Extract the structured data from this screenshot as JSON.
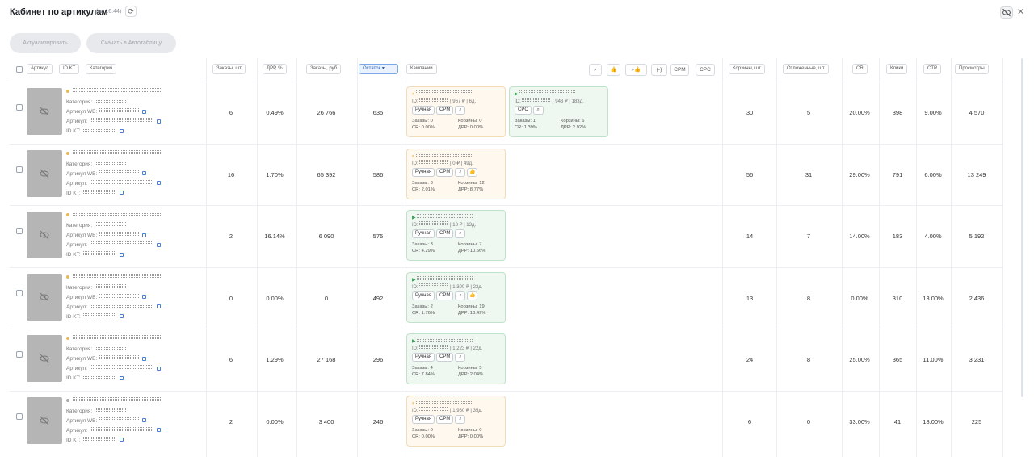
{
  "header": {
    "title": "Кабинет по артикулам",
    "subtitle": "(за 16:44)"
  },
  "actions": {
    "update": "Актуализировать",
    "download": "Скачать в Автотаблицу"
  },
  "columns": {
    "article": "Артикул",
    "idkt": "ID KT",
    "category": "Категория",
    "orders": "Заказы, шт",
    "drr": "ДРР, %",
    "orders_rub": "Заказы, руб",
    "stock": "Остаток",
    "campaigns": "Кампании",
    "carts": "Корзины, шт",
    "deferred": "Отложенные, шт",
    "cr": "CR",
    "clicks": "Клики",
    "ctr": "CTR",
    "views": "Просмотры"
  },
  "filters": {
    "cpm": "CPM",
    "cpc": "CPC",
    "braces": "{-}"
  },
  "labels": {
    "category": "Категория:",
    "art_wb": "Артикул WB:",
    "art": "Артикул:",
    "id_kt": "ID KT:",
    "id": "ID:",
    "manual": "Ручная",
    "cpm": "CPM",
    "cpc": "CPC",
    "orders": "Заказы:",
    "carts": "Корзины:",
    "cr": "CR:",
    "drr": "ДРР:"
  },
  "colors": {
    "accent": "#2a63b4",
    "warm": "#e6b85c",
    "green": "#3fa35b"
  },
  "rows": [
    {
      "orders": "6",
      "drr": "0.49%",
      "orders_rub": "26 766",
      "stock": "635",
      "carts": "30",
      "deferred": "5",
      "cr": "20.00%",
      "clicks": "398",
      "ctr": "9.00%",
      "views": "4 570",
      "status": "warm",
      "campaigns": [
        {
          "state": "paused",
          "meta": "| 967 ₽ | 6д.",
          "tags": [
            "manual",
            "cpm",
            "search"
          ],
          "orders": "0",
          "carts": "0",
          "cr": "0.00%",
          "drr": "0.00%"
        },
        {
          "state": "active",
          "meta": "| 943 ₽ | 183д.",
          "tags": [
            "cpc",
            "search"
          ],
          "orders": "1",
          "carts": "6",
          "cr": "1.39%",
          "drr": "2.92%"
        }
      ]
    },
    {
      "orders": "16",
      "drr": "1.70%",
      "orders_rub": "65 392",
      "stock": "586",
      "carts": "56",
      "deferred": "31",
      "cr": "29.00%",
      "clicks": "791",
      "ctr": "6.00%",
      "views": "13 249",
      "status": "warm",
      "campaigns": [
        {
          "state": "paused",
          "meta": "| 0 ₽ | 49д.",
          "tags": [
            "manual",
            "cpm",
            "search",
            "like"
          ],
          "orders": "3",
          "carts": "12",
          "cr": "2.01%",
          "drr": "8.77%"
        }
      ]
    },
    {
      "orders": "2",
      "drr": "16.14%",
      "orders_rub": "6 090",
      "stock": "575",
      "carts": "14",
      "deferred": "7",
      "cr": "14.00%",
      "clicks": "183",
      "ctr": "4.00%",
      "views": "5 192",
      "status": "warm",
      "campaigns": [
        {
          "state": "active",
          "meta": "| 18 ₽ | 13д.",
          "tags": [
            "manual",
            "cpm",
            "search"
          ],
          "orders": "3",
          "carts": "7",
          "cr": "4.29%",
          "drr": "10.56%"
        }
      ]
    },
    {
      "orders": "0",
      "drr": "0.00%",
      "orders_rub": "0",
      "stock": "492",
      "carts": "13",
      "deferred": "8",
      "cr": "0.00%",
      "clicks": "310",
      "ctr": "13.00%",
      "views": "2 436",
      "status": "warm",
      "campaigns": [
        {
          "state": "active",
          "meta": "| 1 300 ₽ | 22д.",
          "tags": [
            "manual",
            "cpm",
            "search",
            "like"
          ],
          "orders": "2",
          "carts": "19",
          "cr": "1.76%",
          "drr": "13.49%"
        }
      ]
    },
    {
      "orders": "6",
      "drr": "1.29%",
      "orders_rub": "27 168",
      "stock": "296",
      "carts": "24",
      "deferred": "8",
      "cr": "25.00%",
      "clicks": "365",
      "ctr": "11.00%",
      "views": "3 231",
      "status": "warm",
      "campaigns": [
        {
          "state": "active",
          "meta": "| 1 223 ₽ | 22д.",
          "tags": [
            "manual",
            "cpm",
            "search"
          ],
          "orders": "4",
          "carts": "5",
          "cr": "7.84%",
          "drr": "2.04%"
        }
      ]
    },
    {
      "orders": "2",
      "drr": "0.00%",
      "orders_rub": "3 400",
      "stock": "246",
      "carts": "6",
      "deferred": "0",
      "cr": "33.00%",
      "clicks": "41",
      "ctr": "18.00%",
      "views": "225",
      "status": "gray",
      "campaigns": [
        {
          "state": "paused",
          "meta": "| 1 980 ₽ | 35д.",
          "tags": [
            "manual",
            "cpm",
            "search"
          ],
          "orders": "0",
          "carts": "0",
          "cr": "0.00%",
          "drr": "0.00%"
        }
      ]
    }
  ]
}
